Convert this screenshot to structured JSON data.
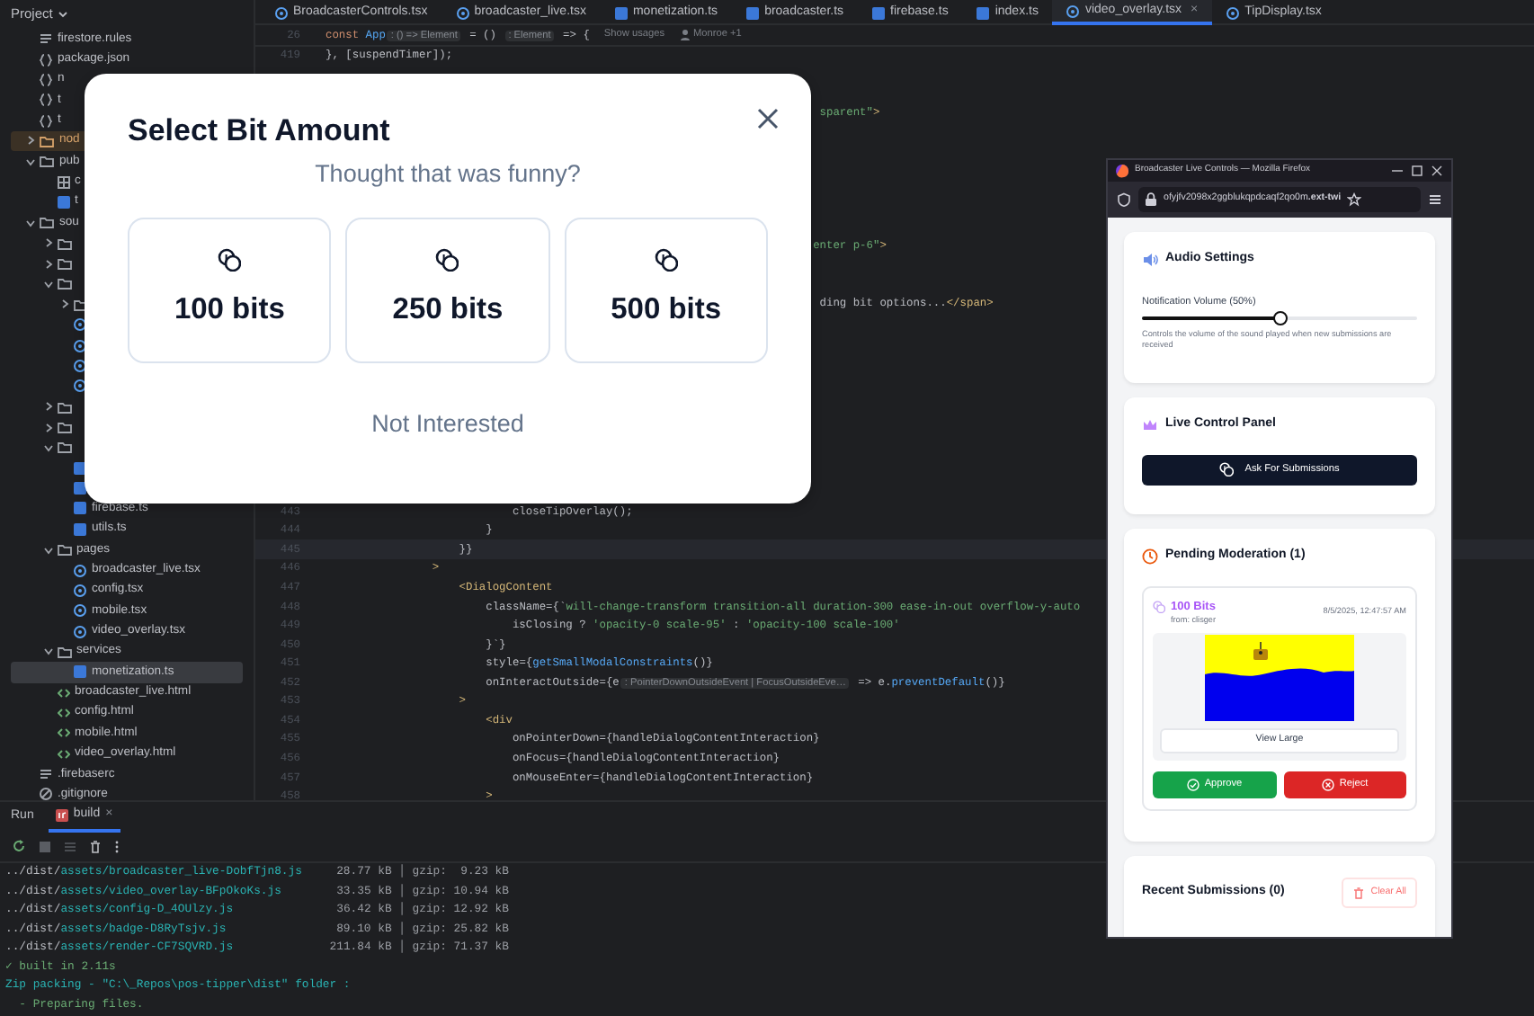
{
  "sidebar": {
    "title": "Project",
    "tree": [
      {
        "kind": "rules",
        "label": "firestore.rules"
      },
      {
        "kind": "json",
        "label": "package.json"
      },
      {
        "kind": "json",
        "label": "n"
      },
      {
        "kind": "json",
        "label": "t"
      },
      {
        "kind": "json",
        "label": "t"
      },
      {
        "kind": "folder",
        "label": "nod",
        "expanded": false,
        "excluded": true
      },
      {
        "kind": "folder",
        "label": "pub",
        "expanded": true,
        "excluded": false,
        "children": [
          {
            "label": "c"
          },
          {
            "kind": "ts",
            "label": "t"
          }
        ]
      },
      {
        "kind": "folder",
        "label": "sou",
        "expanded": true,
        "excluded": false,
        "children": [
          {
            "kind": "folder",
            "expanded": false,
            "excluded": false
          },
          {
            "kind": "folder",
            "expanded": false,
            "excluded": false
          },
          {
            "kind": "folder",
            "expanded": true,
            "excluded": false,
            "children": [
              {
                "kind": "folder",
                "expanded": false,
                "excluded": false
              },
              {
                "kind": "tsx"
              },
              {
                "kind": "tsx"
              },
              {
                "kind": "tsx"
              },
              {
                "kind": "tsx"
              }
            ]
          },
          {
            "kind": "folder",
            "expanded": false,
            "excluded": false
          },
          {
            "kind": "folder",
            "expanded": false,
            "excluded": false
          },
          {
            "kind": "folder",
            "expanded": true,
            "excluded": false,
            "children": [
              {
                "kind": "ts"
              },
              {
                "kind": "ts"
              },
              {
                "kind": "ts",
                "label": "firebase.ts"
              },
              {
                "kind": "ts",
                "label": "utils.ts"
              }
            ]
          },
          {
            "kind": "folder",
            "label": "pages",
            "expanded": true,
            "excluded": false,
            "children": [
              {
                "kind": "tsx",
                "label": "broadcaster_live.tsx"
              },
              {
                "kind": "tsx",
                "label": "config.tsx"
              },
              {
                "kind": "tsx",
                "label": "mobile.tsx"
              },
              {
                "kind": "tsx",
                "label": "video_overlay.tsx"
              }
            ]
          },
          {
            "kind": "folder",
            "label": "services",
            "expanded": true,
            "excluded": false,
            "children": [
              {
                "kind": "ts",
                "label": "monetization.ts",
                "selected": true
              }
            ]
          },
          {
            "kind": "html",
            "label": "broadcaster_live.html"
          },
          {
            "kind": "html",
            "label": "config.html"
          },
          {
            "kind": "html",
            "label": "mobile.html"
          },
          {
            "kind": "html",
            "label": "video_overlay.html"
          }
        ]
      },
      {
        "kind": "rules",
        "label": ".firebaserc"
      },
      {
        "kind": "ignore",
        "label": ".gitignore"
      }
    ]
  },
  "editor_tabs": [
    {
      "label": "BroadcasterControls.tsx",
      "kind": "tsx",
      "selected": false
    },
    {
      "label": "broadcaster_live.tsx",
      "kind": "tsx",
      "selected": false
    },
    {
      "label": "monetization.ts",
      "kind": "ts",
      "selected": false
    },
    {
      "label": "broadcaster.ts",
      "kind": "ts",
      "selected": false
    },
    {
      "label": "firebase.ts",
      "kind": "ts",
      "selected": false
    },
    {
      "label": "index.ts",
      "kind": "ts",
      "selected": false
    },
    {
      "label": "video_overlay.tsx",
      "kind": "tsx",
      "selected": true,
      "close": "×"
    },
    {
      "label": "TipDisplay.tsx",
      "kind": "tsx",
      "selected": false
    }
  ],
  "editor": {
    "sticky_line": {
      "number": "26",
      "parts": [
        {
          "text": "const ",
          "kind": "keyword"
        },
        {
          "text": "App",
          "kind": "fn"
        },
        {
          "text": ": () => Element",
          "kind": "hint"
        },
        {
          "text": " = () ",
          "kind": "plain"
        },
        {
          "text": ": Element",
          "kind": "hint"
        },
        {
          "text": " => {",
          "kind": "plain"
        },
        {
          "text": "Show usages",
          "kind": "usage"
        },
        {
          "text": "Monroe +1",
          "kind": "author"
        }
      ]
    },
    "lines": [
      {
        "number": "419",
        "parts": [
          {
            "text": "}, [suspendTimer]);",
            "kind": "plain"
          }
        ]
      },
      {
        "parts": [
          {
            "text": "                                                                          sparent\"",
            "kind": "string"
          },
          {
            "text": ">",
            "kind": "tag"
          }
        ]
      },
      {
        "parts": [
          {
            "text": "                                                                         enter p-6\"",
            "kind": "string"
          },
          {
            "text": ">",
            "kind": "tag"
          }
        ]
      },
      {
        "parts": [
          {
            "text": "                                                                          ding bit options...",
            "kind": "plain"
          },
          {
            "text": "</span>",
            "kind": "tag"
          }
        ]
      },
      {
        "number": "443",
        "parts": [
          {
            "text": "                            closeTipOverlay();",
            "kind": "plain"
          }
        ]
      },
      {
        "number": "444",
        "parts": [
          {
            "text": "                        }",
            "kind": "plain"
          }
        ]
      },
      {
        "number": "445",
        "current": true,
        "parts": [
          {
            "text": "                    }}",
            "kind": "plain"
          }
        ]
      },
      {
        "number": "446",
        "parts": [
          {
            "text": "                >",
            "kind": "tag"
          }
        ]
      },
      {
        "number": "447",
        "parts": [
          {
            "text": "                    <DialogContent",
            "kind": "tag"
          }
        ]
      },
      {
        "number": "448",
        "parts": [
          {
            "text": "                        className={`",
            "kind": "plain"
          },
          {
            "text": "will-change-transform transition-all duration-300 ease-in-out overflow-y-auto",
            "kind": "string"
          }
        ]
      },
      {
        "number": "449",
        "parts": [
          {
            "text": "                            isClosing ? ",
            "kind": "plain"
          },
          {
            "text": "'opacity-0 scale-95'",
            "kind": "string"
          },
          {
            "text": " : ",
            "kind": "plain"
          },
          {
            "text": "'opacity-100 scale-100'",
            "kind": "string"
          }
        ]
      },
      {
        "number": "450",
        "parts": [
          {
            "text": "                        }`}",
            "kind": "plain"
          }
        ]
      },
      {
        "number": "451",
        "parts": [
          {
            "text": "                        style={",
            "kind": "plain"
          },
          {
            "text": "getSmallModalConstraints",
            "kind": "fn"
          },
          {
            "text": "()}",
            "kind": "plain"
          }
        ]
      },
      {
        "number": "452",
        "parts": [
          {
            "text": "                        onInteractOutside={e",
            "kind": "plain"
          },
          {
            "text": ": PointerDownOutsideEvent | FocusOutsideEve…",
            "kind": "hint"
          },
          {
            "text": " => e.",
            "kind": "plain"
          },
          {
            "text": "preventDefault",
            "kind": "fn"
          },
          {
            "text": "()}",
            "kind": "plain"
          }
        ]
      },
      {
        "number": "453",
        "parts": [
          {
            "text": "                    >",
            "kind": "tag"
          }
        ]
      },
      {
        "number": "454",
        "parts": [
          {
            "text": "                        <div",
            "kind": "tag"
          }
        ]
      },
      {
        "number": "455",
        "parts": [
          {
            "text": "                            onPointerDown={handleDialogContentInteraction}",
            "kind": "plain"
          }
        ]
      },
      {
        "number": "456",
        "parts": [
          {
            "text": "                            onFocus={handleDialogContentInteraction}",
            "kind": "plain"
          }
        ]
      },
      {
        "number": "457",
        "parts": [
          {
            "text": "                            onMouseEnter={handleDialogContentInteraction}",
            "kind": "plain"
          }
        ]
      },
      {
        "number": "458",
        "parts": [
          {
            "text": "                        >",
            "kind": "tag"
          }
        ]
      }
    ]
  },
  "run_panel": {
    "title": "Run",
    "tabs": [
      {
        "label": "build",
        "selected": true,
        "close": "×"
      }
    ],
    "output": [
      {
        "parts": [
          {
            "text": "../dist/",
            "kind": "plain"
          },
          {
            "text": "assets/broadcaster_live-DobfTjn8.js",
            "kind": "path"
          },
          {
            "text": "     28.77 kB │ gzip:  9.23 kB",
            "kind": "dim"
          }
        ]
      },
      {
        "parts": [
          {
            "text": "../dist/",
            "kind": "plain"
          },
          {
            "text": "assets/video_overlay-BFpOkoKs.js",
            "kind": "path"
          },
          {
            "text": "        33.35 kB │ gzip: 10.94 kB",
            "kind": "dim"
          }
        ]
      },
      {
        "parts": [
          {
            "text": "../dist/",
            "kind": "plain"
          },
          {
            "text": "assets/config-D_4OUlzy.js",
            "kind": "path"
          },
          {
            "text": "               36.42 kB │ gzip: 12.92 kB",
            "kind": "dim"
          }
        ]
      },
      {
        "parts": [
          {
            "text": "../dist/",
            "kind": "plain"
          },
          {
            "text": "assets/badge-D8RyTsjv.js",
            "kind": "path"
          },
          {
            "text": "                89.10 kB │ gzip: 25.82 kB",
            "kind": "dim"
          }
        ]
      },
      {
        "parts": [
          {
            "text": "../dist/",
            "kind": "plain"
          },
          {
            "text": "assets/render-CF7SQVRD.js",
            "kind": "path"
          },
          {
            "text": "              211.84 kB │ gzip: 71.37 kB",
            "kind": "dim"
          }
        ]
      },
      {
        "parts": [
          {
            "text": "✓ built in 2.11s",
            "kind": "success"
          }
        ]
      },
      {
        "parts": [
          {
            "text": "Zip packing - \"C:\\_Repos\\pos-tipper\\dist\" folder :",
            "kind": "path"
          }
        ]
      },
      {
        "parts": [
          {
            "text": "  - Preparing files.",
            "kind": "success"
          }
        ]
      }
    ]
  },
  "dialog": {
    "title": "Select Bit Amount",
    "subtitle": "Thought that was funny?",
    "options": [
      {
        "label": "100 bits"
      },
      {
        "label": "250 bits"
      },
      {
        "label": "500 bits"
      }
    ],
    "dismiss": "Not Interested"
  },
  "browser": {
    "title": "Broadcaster Live Controls — Mozilla Firefox",
    "url": "ofyjfv2098x2ggblukqpdcaqf2qo0m**.ext-twi**",
    "audio": {
      "heading": "Audio Settings",
      "volume_label": "Notification Volume (50%)",
      "level": 0.5,
      "help": "Controls the volume of the sound played when new submissions are received"
    },
    "live": {
      "heading": "Live Control Panel",
      "button": "Ask For Submissions"
    },
    "pending": {
      "heading": "Pending Moderation (1)",
      "items": [
        {
          "amount": "100 Bits",
          "from": "from: clisger",
          "time": "8/5/2025, 12:47:57 AM",
          "kind": "picture",
          "view": "View Large",
          "approve": "Approve",
          "reject": "Reject"
        }
      ]
    },
    "recent": {
      "heading": "Recent Submissions (0)",
      "clear": "Clear All"
    }
  }
}
